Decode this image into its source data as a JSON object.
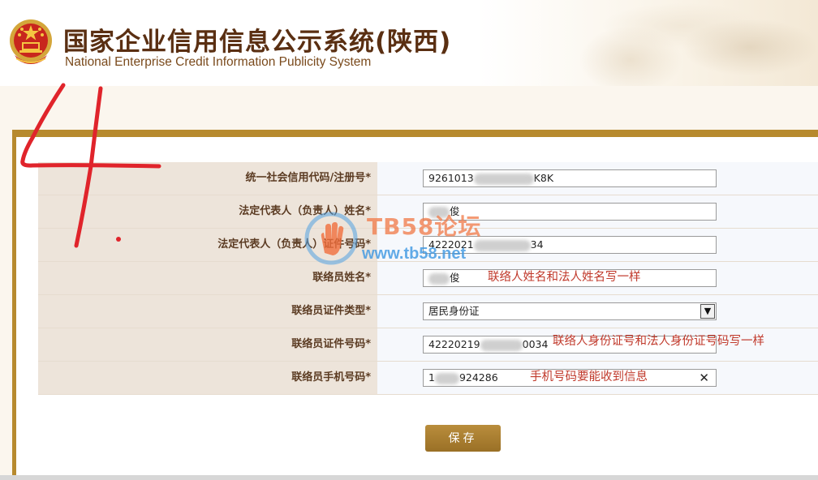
{
  "header": {
    "title_cn": "国家企业信用信息公示系统(陕西)",
    "title_en": "National Enterprise Credit Information Publicity System"
  },
  "form": {
    "rows": [
      {
        "label": "统一社会信用代码/注册号*",
        "value_start": "9261013",
        "value_end": "K8K"
      },
      {
        "label": "法定代表人（负责人）姓名*",
        "value_start": "",
        "value_end": "俊"
      },
      {
        "label": "法定代表人（负责人）证件号码*",
        "value_start": "4222021",
        "value_end": "34"
      },
      {
        "label": "联络员姓名*",
        "value_start": "",
        "value_end": "俊",
        "note": "联络人姓名和法人姓名写一样"
      },
      {
        "label": "联络员证件类型*",
        "value": "居民身份证"
      },
      {
        "label": "联络员证件号码*",
        "value_start": "42220219",
        "value_end": "0034",
        "note": "联络人身份证号和法人身份证号码写一样"
      },
      {
        "label": "联络员手机号码*",
        "value_start": "1",
        "value_end": "924286",
        "note": "手机号码要能收到信息"
      }
    ]
  },
  "save_label": "保存",
  "watermark": {
    "title": "TB58论坛",
    "url": "www.tb58.net"
  },
  "annotation": {
    "handwritten": "4."
  },
  "colors": {
    "gold": "#b78a2e",
    "title_brown": "#5a2f12",
    "note_red": "#c0392b",
    "scribble_red": "#e0242b"
  }
}
